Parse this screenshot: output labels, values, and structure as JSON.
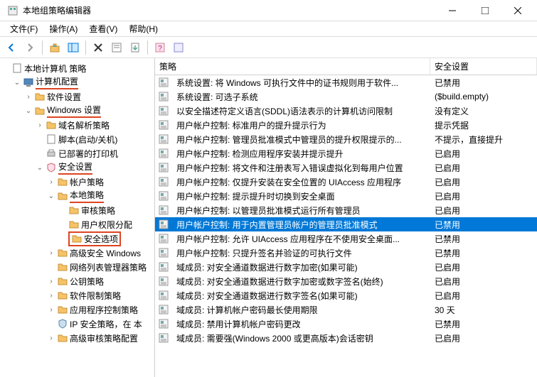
{
  "window": {
    "title": "本地组策略编辑器"
  },
  "menubar": {
    "file": "文件(F)",
    "action": "操作(A)",
    "view": "查看(V)",
    "help": "帮助(H)"
  },
  "tree": {
    "root": "本地计算机 策略",
    "computer_config": "计算机配置",
    "software_settings": "软件设置",
    "windows_settings": "Windows 设置",
    "dns_policy": "域名解析策略",
    "scripts": "脚本(启动/关机)",
    "deployed_printers": "已部署的打印机",
    "security_settings": "安全设置",
    "account_policies": "帐户策略",
    "local_policies": "本地策略",
    "audit_policy": "审核策略",
    "user_rights": "用户权限分配",
    "security_options": "安全选项",
    "advanced_security": "高级安全 Windows",
    "network_list": "网络列表管理器策略",
    "public_key": "公钥策略",
    "software_restriction": "软件限制策略",
    "app_control": "应用程序控制策略",
    "ip_security": "IP 安全策略，在 本",
    "advanced_audit": "高级审核策略配置"
  },
  "list": {
    "header_policy": "策略",
    "header_setting": "安全设置",
    "items": [
      {
        "policy": "系统设置: 将 Windows 可执行文件中的证书规则用于软件...",
        "setting": "已禁用"
      },
      {
        "policy": "系统设置: 可选子系统",
        "setting": "($build.empty)"
      },
      {
        "policy": "以安全描述符定义语言(SDDL)语法表示的计算机访问限制",
        "setting": "没有定义"
      },
      {
        "policy": "用户帐户控制: 标准用户的提升提示行为",
        "setting": "提示凭据"
      },
      {
        "policy": "用户帐户控制: 管理员批准模式中管理员的提升权限提示的...",
        "setting": "不提示，直接提升"
      },
      {
        "policy": "用户帐户控制: 检测应用程序安装并提示提升",
        "setting": "已启用"
      },
      {
        "policy": "用户帐户控制: 将文件和注册表写入错误虚拟化到每用户位置",
        "setting": "已启用"
      },
      {
        "policy": "用户帐户控制: 仅提升安装在安全位置的 UIAccess 应用程序",
        "setting": "已启用"
      },
      {
        "policy": "用户帐户控制: 提示提升时切换到安全桌面",
        "setting": "已启用"
      },
      {
        "policy": "用户帐户控制: 以管理员批准模式运行所有管理员",
        "setting": "已启用"
      },
      {
        "policy": "用户帐户控制: 用于内置管理员帐户的管理员批准模式",
        "setting": "已禁用",
        "selected": true
      },
      {
        "policy": "用户帐户控制: 允许 UIAccess 应用程序在不使用安全桌面...",
        "setting": "已禁用"
      },
      {
        "policy": "用户帐户控制: 只提升签名并验证的可执行文件",
        "setting": "已禁用"
      },
      {
        "policy": "域成员: 对安全通道数据进行数字加密(如果可能)",
        "setting": "已启用"
      },
      {
        "policy": "域成员: 对安全通道数据进行数字加密或数字签名(始终)",
        "setting": "已启用"
      },
      {
        "policy": "域成员: 对安全通道数据进行数字签名(如果可能)",
        "setting": "已启用"
      },
      {
        "policy": "域成员: 计算机帐户密码最长使用期限",
        "setting": "30 天"
      },
      {
        "policy": "域成员: 禁用计算机帐户密码更改",
        "setting": "已禁用"
      },
      {
        "policy": "域成员: 需要强(Windows 2000 或更高版本)会话密钥",
        "setting": "已启用"
      }
    ]
  }
}
